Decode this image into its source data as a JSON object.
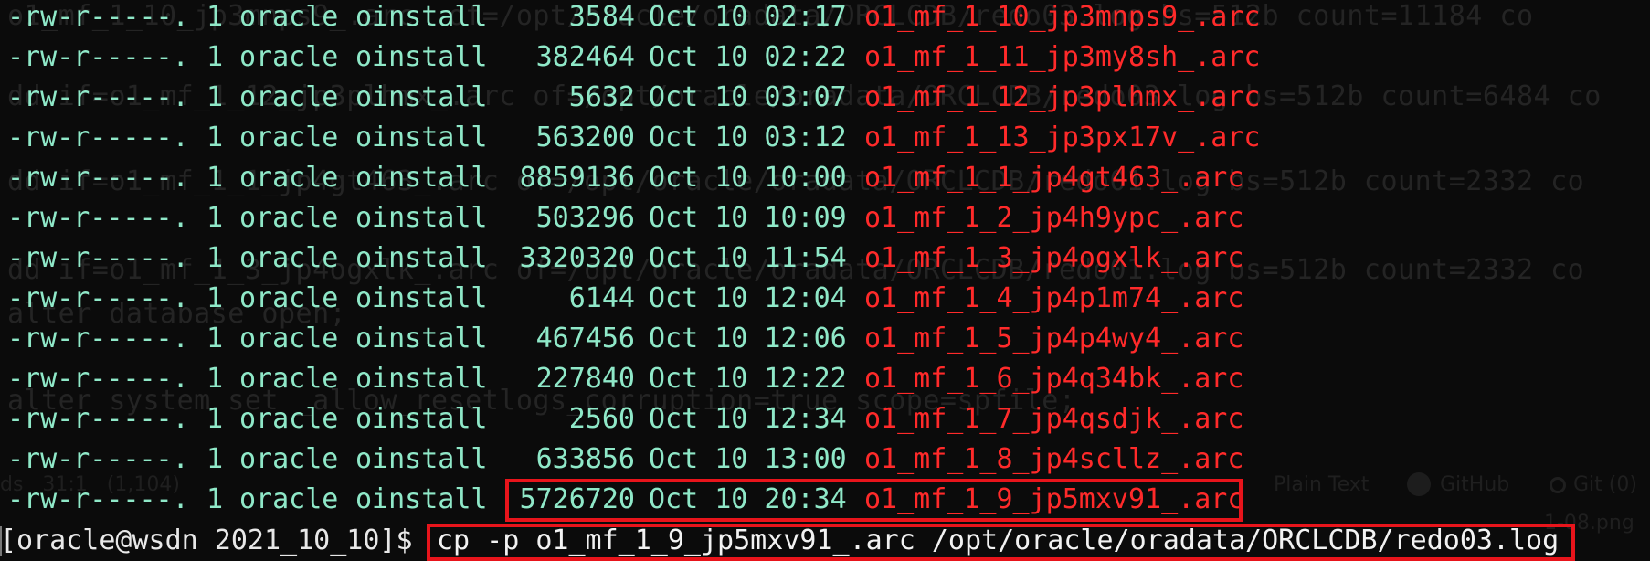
{
  "background_ghost_text": {
    "lines": [
      "o1_mf_1_10_jp3mnps9_.arc  of=/opt/oracle/oradata/ORCLCDB/redo03.log bs=512b count=11184 co",
      "dd if=o1_mf_1_12_jp3plhmx_.arc of=/opt/oracle/oradata/ORCLCDB/redo03.log bs=512b count=6484 co",
      "dd if=o1_mf_1_1_jp4gt463_.arc of=/opt/oracle/oradata/ORCLCDB/redo01.log bs=512b count=2332 co",
      "dd if=o1_mf_1_3_jp4ogxlk_.arc of=/opt/oracle/oradata/ORCLCDB/redo01.log bs=512b count=2332 co",
      "alter database open;",
      "alter system set _allow_resetlogs_corruption=true scope=spfile;"
    ],
    "status_left": "ds   31:1   (1,104)",
    "status_plain": "Plain Text",
    "status_github": "GitHub",
    "status_git": "Git (0)",
    "status_png": "1-08.png"
  },
  "listing": [
    {
      "perm": "-rw-r-----.",
      "links": "1",
      "owner": "oracle",
      "group": "oinstall",
      "size": "3584",
      "date": "Oct 10 02:17",
      "name": "o1_mf_1_10_jp3mnps9_.arc"
    },
    {
      "perm": "-rw-r-----.",
      "links": "1",
      "owner": "oracle",
      "group": "oinstall",
      "size": "382464",
      "date": "Oct 10 02:22",
      "name": "o1_mf_1_11_jp3my8sh_.arc"
    },
    {
      "perm": "-rw-r-----.",
      "links": "1",
      "owner": "oracle",
      "group": "oinstall",
      "size": "5632",
      "date": "Oct 10 03:07",
      "name": "o1_mf_1_12_jp3plhmx_.arc"
    },
    {
      "perm": "-rw-r-----.",
      "links": "1",
      "owner": "oracle",
      "group": "oinstall",
      "size": "563200",
      "date": "Oct 10 03:12",
      "name": "o1_mf_1_13_jp3px17v_.arc"
    },
    {
      "perm": "-rw-r-----.",
      "links": "1",
      "owner": "oracle",
      "group": "oinstall",
      "size": "8859136",
      "date": "Oct 10 10:00",
      "name": "o1_mf_1_1_jp4gt463_.arc"
    },
    {
      "perm": "-rw-r-----.",
      "links": "1",
      "owner": "oracle",
      "group": "oinstall",
      "size": "503296",
      "date": "Oct 10 10:09",
      "name": "o1_mf_1_2_jp4h9ypc_.arc"
    },
    {
      "perm": "-rw-r-----.",
      "links": "1",
      "owner": "oracle",
      "group": "oinstall",
      "size": "3320320",
      "date": "Oct 10 11:54",
      "name": "o1_mf_1_3_jp4ogxlk_.arc"
    },
    {
      "perm": "-rw-r-----.",
      "links": "1",
      "owner": "oracle",
      "group": "oinstall",
      "size": "6144",
      "date": "Oct 10 12:04",
      "name": "o1_mf_1_4_jp4p1m74_.arc"
    },
    {
      "perm": "-rw-r-----.",
      "links": "1",
      "owner": "oracle",
      "group": "oinstall",
      "size": "467456",
      "date": "Oct 10 12:06",
      "name": "o1_mf_1_5_jp4p4wy4_.arc"
    },
    {
      "perm": "-rw-r-----.",
      "links": "1",
      "owner": "oracle",
      "group": "oinstall",
      "size": "227840",
      "date": "Oct 10 12:22",
      "name": "o1_mf_1_6_jp4q34bk_.arc"
    },
    {
      "perm": "-rw-r-----.",
      "links": "1",
      "owner": "oracle",
      "group": "oinstall",
      "size": "2560",
      "date": "Oct 10 12:34",
      "name": "o1_mf_1_7_jp4qsdjk_.arc"
    },
    {
      "perm": "-rw-r-----.",
      "links": "1",
      "owner": "oracle",
      "group": "oinstall",
      "size": "633856",
      "date": "Oct 10 13:00",
      "name": "o1_mf_1_8_jp4scllz_.arc"
    },
    {
      "perm": "-rw-r-----.",
      "links": "1",
      "owner": "oracle",
      "group": "oinstall",
      "size": "5726720",
      "date": "Oct 10 20:34",
      "name": "o1_mf_1_9_jp5mxv91_.arc"
    }
  ],
  "prompt": {
    "text": "[oracle@wsdn 2021_10_10]$",
    "command": "cp -p o1_mf_1_9_jp5mxv91_.arc /opt/oracle/oradata/ORCLCDB/redo03.log"
  },
  "colors": {
    "background": "#0b0b0b",
    "listing_text": "#8fe8c8",
    "archive_filename": "#ff2a2a",
    "prompt_text": "#e8e8e8",
    "highlight_box": "#e8141b"
  }
}
